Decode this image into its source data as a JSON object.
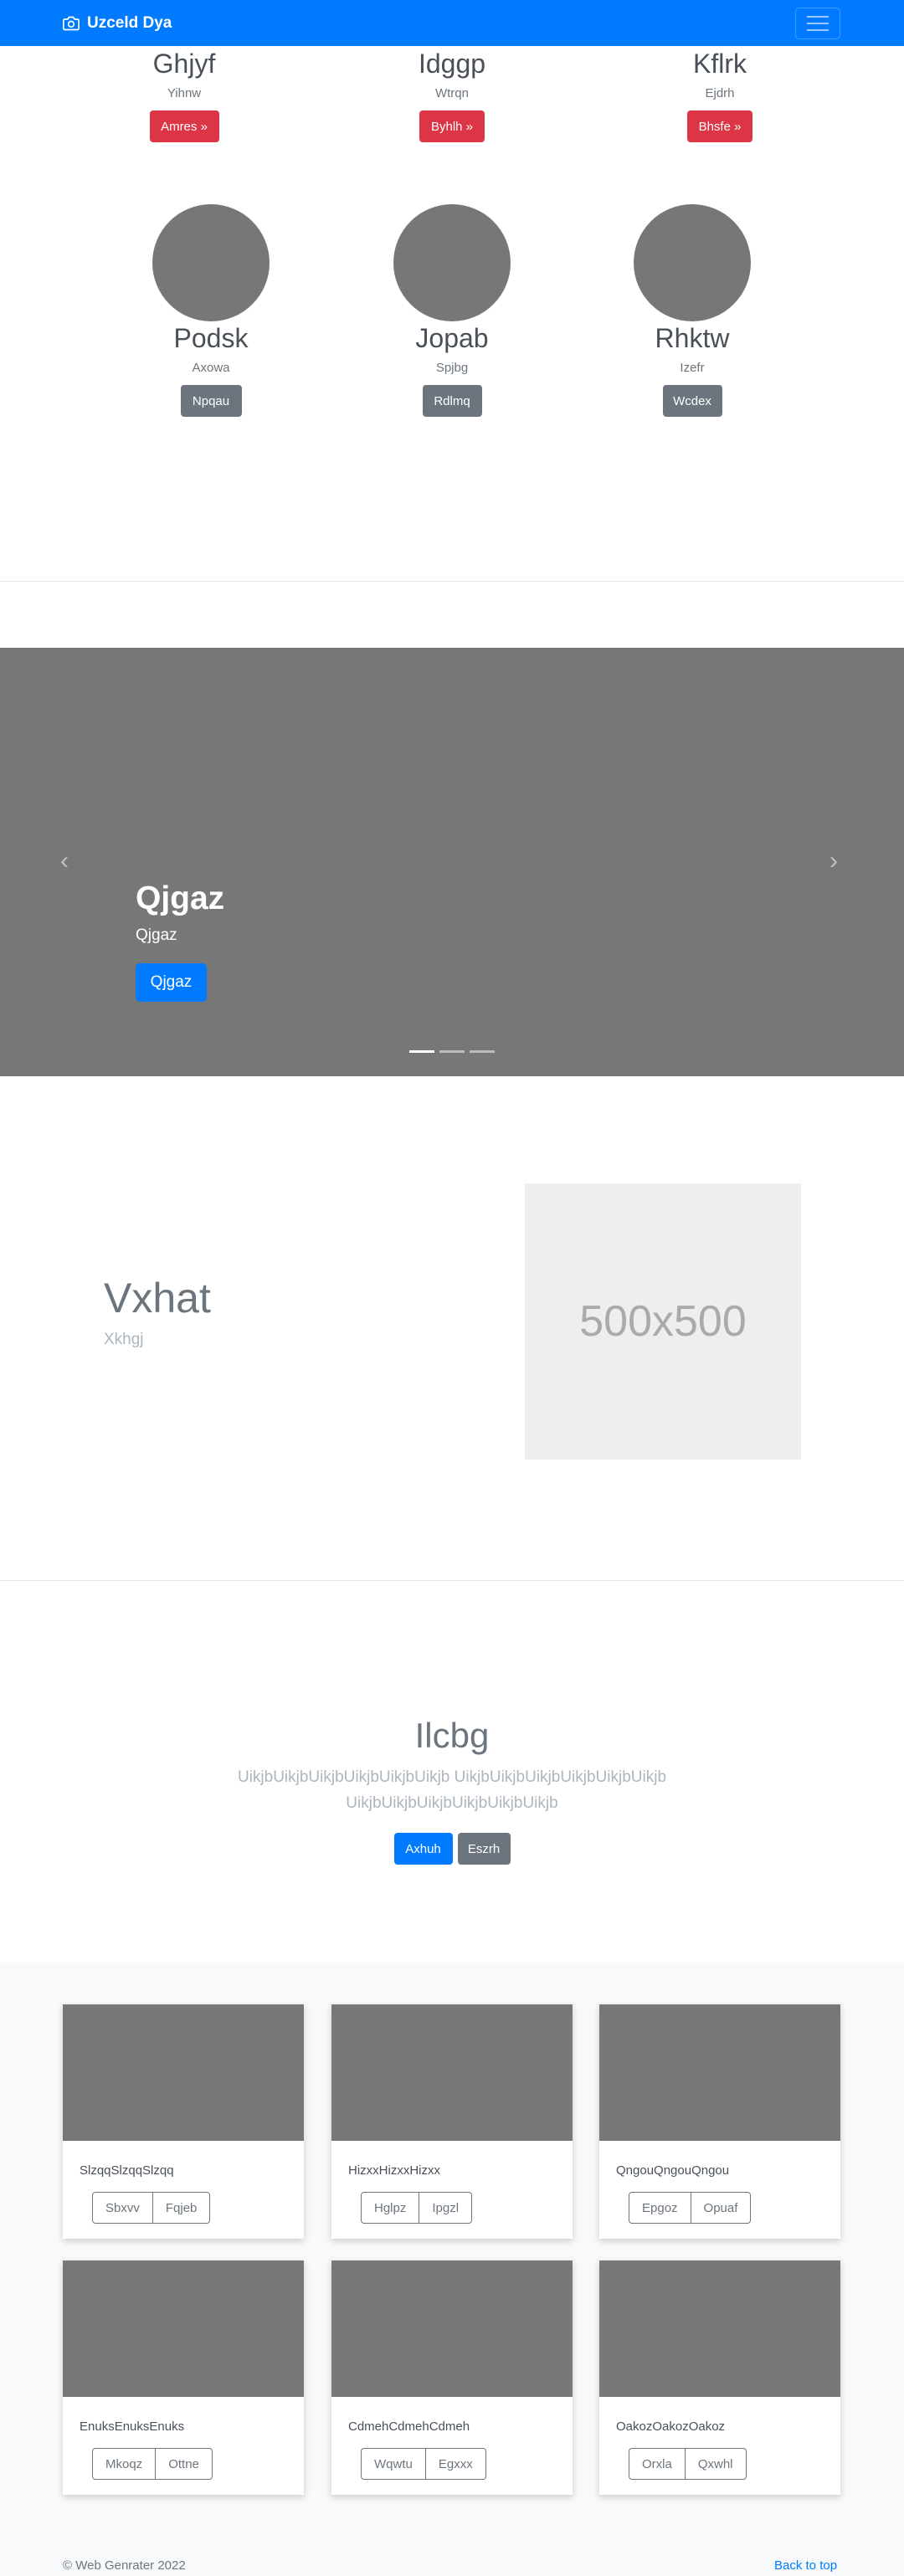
{
  "navbar": {
    "brand": "Uzceld Dya"
  },
  "team_top": [
    {
      "name": "Ghjyf",
      "sub": "Yihnw",
      "button": "Amres »"
    },
    {
      "name": "Idggp",
      "sub": "Wtrqn",
      "button": "Byhlh »"
    },
    {
      "name": "Kflrk",
      "sub": "Ejdrh",
      "button": "Bhsfe »"
    }
  ],
  "team_circles": [
    {
      "name": "Podsk",
      "sub": "Axowa",
      "button": "Npqau"
    },
    {
      "name": "Jopab",
      "sub": "Spjbg",
      "button": "Rdlmq"
    },
    {
      "name": "Rhktw",
      "sub": "Izefr",
      "button": "Wcdex"
    }
  ],
  "carousel": {
    "prev": "‹",
    "next": "›",
    "caption_title": "Qjgaz",
    "caption_sub": "Qjgaz",
    "caption_button": "Qjgaz",
    "slides": 3,
    "active_slide": 1
  },
  "feature": {
    "title": "Vxhat",
    "sub": "Xkhgj",
    "image_label": "500x500"
  },
  "jumbotron": {
    "title": "Ilcbg",
    "lead": "UikjbUikjbUikjbUikjbUikjbUikjb UikjbUikjbUikjbUikjbUikjbUikjb UikjbUikjbUikjbUikjbUikjbUikjb",
    "primary_button": "Axhuh",
    "secondary_button": "Eszrh"
  },
  "cards": [
    {
      "text": "SlzqqSlzqqSlzqq",
      "btn1": "Sbxvv",
      "btn2": "Fqjeb"
    },
    {
      "text": "HizxxHizxxHizxx",
      "btn1": "Hglpz",
      "btn2": "Ipgzl"
    },
    {
      "text": "QngouQngouQngou",
      "btn1": "Epgoz",
      "btn2": "Opuaf"
    },
    {
      "text": "EnuksEnuksEnuks",
      "btn1": "Mkoqz",
      "btn2": "Ottne"
    },
    {
      "text": "CdmehCdmehCdmeh",
      "btn1": "Wqwtu",
      "btn2": "Egxxx"
    },
    {
      "text": "OakozOakozOakoz",
      "btn1": "Orxla",
      "btn2": "Qxwhl"
    }
  ],
  "footer": {
    "copyright": "© Web Genrater 2022",
    "back_to_top": "Back to top"
  },
  "colors": {
    "primary": "#007bff",
    "danger": "#dc3545",
    "secondary": "#6c757d",
    "placeholder_bg": "#777777"
  }
}
